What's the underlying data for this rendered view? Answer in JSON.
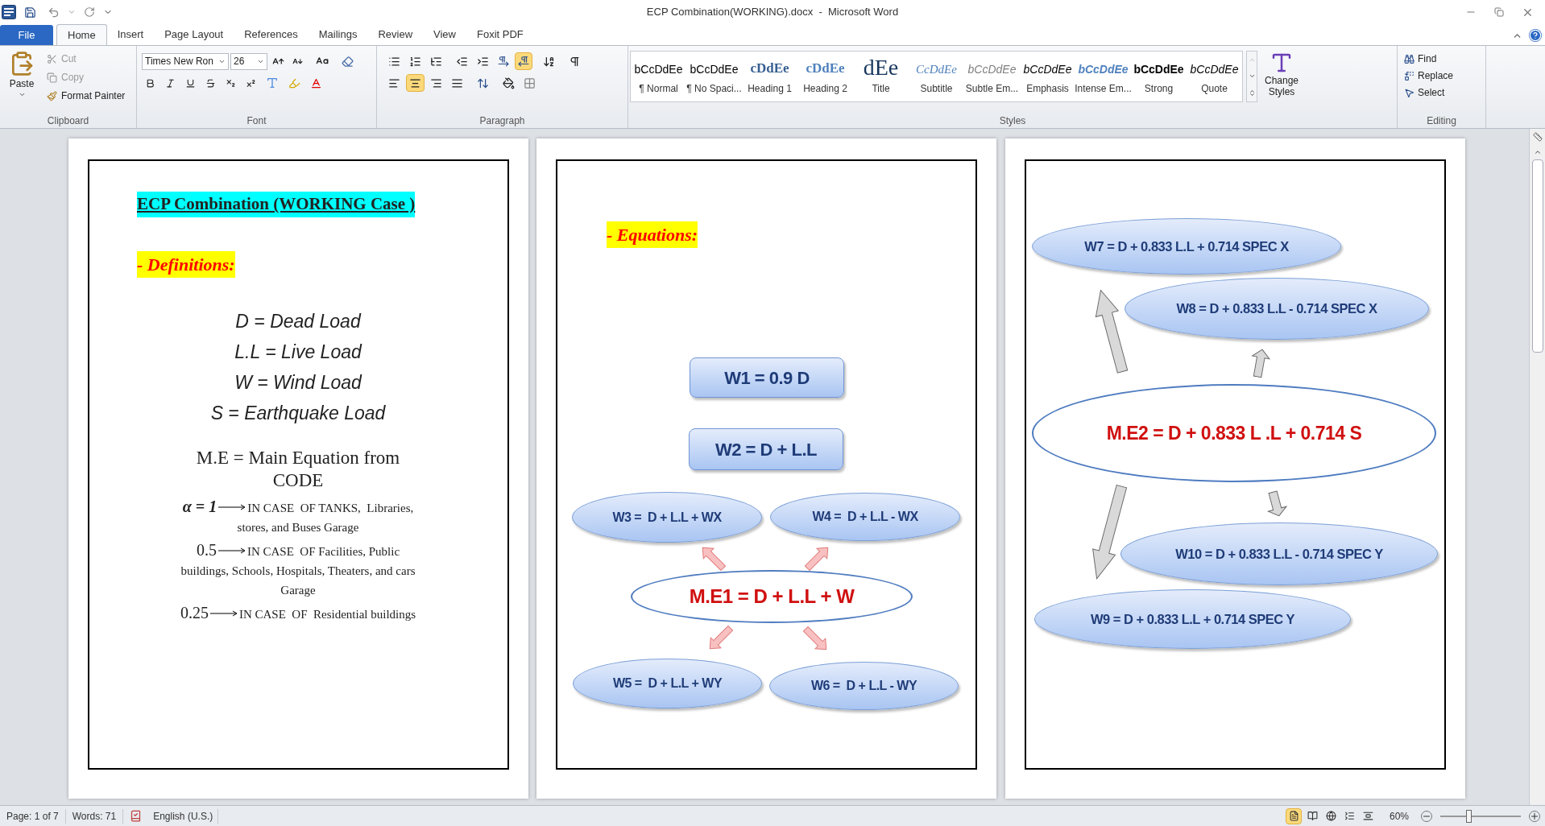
{
  "window": {
    "title": "ECP Combination(WORKING).docx  -  Microsoft Word"
  },
  "ribbon_tabs": [
    {
      "label": "File",
      "kind": "file",
      "selected": false
    },
    {
      "label": "Home",
      "kind": "tab",
      "selected": true
    },
    {
      "label": "Insert",
      "kind": "tab",
      "selected": false
    },
    {
      "label": "Page Layout",
      "kind": "tab",
      "selected": false
    },
    {
      "label": "References",
      "kind": "tab",
      "selected": false
    },
    {
      "label": "Mailings",
      "kind": "tab",
      "selected": false
    },
    {
      "label": "Review",
      "kind": "tab",
      "selected": false
    },
    {
      "label": "View",
      "kind": "tab",
      "selected": false
    },
    {
      "label": "Foxit PDF",
      "kind": "tab",
      "selected": false
    }
  ],
  "clipboard": {
    "group": "Clipboard",
    "paste": "Paste",
    "cut": {
      "label": "Cut",
      "disabled": true
    },
    "copy": {
      "label": "Copy",
      "disabled": true
    },
    "format_painter": "Format Painter"
  },
  "font": {
    "group": "Font",
    "name": "Times New Ron",
    "size": "26"
  },
  "paragraph": {
    "group": "Paragraph",
    "alignments": [
      {
        "selected": false
      },
      {
        "selected": true
      },
      {
        "selected": false
      },
      {
        "selected": false
      }
    ],
    "directions": [
      {
        "selected": false
      },
      {
        "selected": true
      }
    ]
  },
  "styles": {
    "group": "Styles",
    "change_styles": "Change Styles",
    "items": [
      {
        "preview": "bCcDdEe",
        "label": "¶ Normal"
      },
      {
        "preview": "bCcDdEe",
        "label": "¶ No Spaci..."
      },
      {
        "preview": "cDdEe",
        "label": "Heading 1"
      },
      {
        "preview": "cDdEe",
        "label": "Heading 2"
      },
      {
        "preview": "dEe",
        "label": "Title"
      },
      {
        "preview": "CcDdEe",
        "label": "Subtitle"
      },
      {
        "preview": "bCcDdEe",
        "label": "Subtle Em..."
      },
      {
        "preview": "bCcDdEe",
        "label": "Emphasis"
      },
      {
        "preview": "bCcDdEe",
        "label": "Intense Em..."
      },
      {
        "preview": "bCcDdEe",
        "label": "Strong"
      },
      {
        "preview": "bCcDdEe",
        "label": "Quote"
      }
    ]
  },
  "editing": {
    "group": "Editing",
    "items": [
      {
        "label": "Find"
      },
      {
        "label": "Replace"
      },
      {
        "label": "Select"
      }
    ]
  },
  "page1": {
    "title": "ECP Combination (WORKING Case )",
    "section": "- Definitions:",
    "definitions": [
      "D = Dead Load",
      "L.L = Live Load",
      "W = Wind Load",
      "S = Earthquake Load"
    ],
    "main_equation": "M.E = Main Equation from CODE",
    "cases": [
      {
        "value": "α = 1",
        "lines": [
          "IN CASE  OF TANKS,  Libraries,",
          "stores, and Buses Garage"
        ]
      },
      {
        "value": "0.5",
        "lines": [
          "IN CASE  OF Facilities, Public",
          "buildings, Schools, Hospitals, Theaters, and cars",
          "Garage"
        ]
      },
      {
        "value": "0.25",
        "lines": [
          "IN CASE  OF  Residential buildings"
        ]
      }
    ]
  },
  "page2": {
    "section": "- Equations:",
    "nodes": [
      {
        "kind": "box",
        "text": "W1 = 0.9 D"
      },
      {
        "kind": "box",
        "text": "W2 = D + L.L"
      },
      {
        "kind": "ellipse",
        "text": "W3 =  D + L.L + WX"
      },
      {
        "kind": "ellipse",
        "text": "W4 =  D + L.L - WX"
      },
      {
        "kind": "main",
        "text": "M.E1 = D + L.L + W"
      },
      {
        "kind": "ellipse",
        "text": "W5 =  D + L.L + WY"
      },
      {
        "kind": "ellipse",
        "text": "W6 =  D + L.L - WY"
      }
    ]
  },
  "page3": {
    "nodes": [
      {
        "kind": "ellipse",
        "text": "W7 = D + 0.833 L.L + 0.714 SPEC X"
      },
      {
        "kind": "ellipse",
        "text": "W8 = D + 0.833 L.L - 0.714 SPEC X"
      },
      {
        "kind": "main",
        "text": "M.E2 = D + 0.833 L .L + 0.714 S"
      },
      {
        "kind": "ellipse",
        "text": "W10 = D + 0.833 L.L - 0.714 SPEC Y"
      },
      {
        "kind": "ellipse",
        "text": "W9 = D + 0.833 L.L + 0.714 SPEC Y"
      }
    ]
  },
  "status_bar": {
    "page": "Page: 1 of 7",
    "words": "Words: 71",
    "language": "English (U.S.)",
    "views": [
      {
        "selected": true
      },
      {
        "selected": false
      },
      {
        "selected": false
      },
      {
        "selected": false
      },
      {
        "selected": false
      }
    ],
    "zoom": "60%",
    "zoom_slider": {
      "level": 0.35
    }
  }
}
